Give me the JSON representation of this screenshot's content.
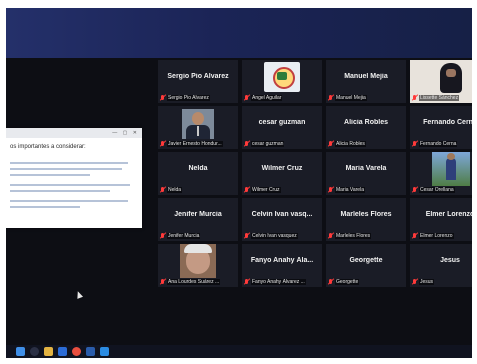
{
  "dialog": {
    "title": "os importantes a considerar:",
    "controls": "— ▢ ✕"
  },
  "participants": [
    {
      "name": "Sergio Pio Alvarez",
      "label": "Sergio Pio Alvarez",
      "kind": "name"
    },
    {
      "name": "",
      "label": "Angel Aguilar",
      "kind": "logo"
    },
    {
      "name": "Manuel Mejia",
      "label": "Manuel Mejia",
      "kind": "name"
    },
    {
      "name": "",
      "label": "Lissette Sánchez",
      "kind": "woman",
      "active": true
    },
    {
      "name": "",
      "label": "Javier Ernesto Hondur...",
      "kind": "person"
    },
    {
      "name": "cesar guzman",
      "label": "cesar guzman",
      "kind": "name"
    },
    {
      "name": "Alicia Robles",
      "label": "Alicia Robles",
      "kind": "name"
    },
    {
      "name": "Fernando Cerna",
      "label": "Fernando Cerna",
      "kind": "name"
    },
    {
      "name": "Nelda",
      "label": "Nelda",
      "kind": "name"
    },
    {
      "name": "Wilmer Cruz",
      "label": "Wilmer Cruz",
      "kind": "name"
    },
    {
      "name": "Maria Varela",
      "label": "Maria Varela",
      "kind": "name"
    },
    {
      "name": "",
      "label": "Cesar Orellana",
      "kind": "outdoor"
    },
    {
      "name": "Jenifer Murcia",
      "label": "Jenifer Murcia",
      "kind": "name"
    },
    {
      "name": "Celvin Ivan vasq...",
      "label": "Celvin Ivan vasquez",
      "kind": "name"
    },
    {
      "name": "Marleles Flores",
      "label": "Marleles Flores",
      "kind": "name"
    },
    {
      "name": "Elmer Lorenzo",
      "label": "Elmer Lorenzo",
      "kind": "name"
    },
    {
      "name": "",
      "label": "Ana Lourdes Suárez ...",
      "kind": "closeup"
    },
    {
      "name": "Fanyo Anahy Ála...",
      "label": "Fanyo Anahy Álvarez ...",
      "kind": "name"
    },
    {
      "name": "Georgette",
      "label": "Georgette",
      "kind": "name"
    },
    {
      "name": "Jesus",
      "label": "Jesus",
      "kind": "name"
    }
  ],
  "taskbar": [
    "windows-icon",
    "search-icon",
    "file-explorer-icon",
    "store-icon",
    "chrome-icon",
    "word-icon",
    "zoom-icon"
  ]
}
